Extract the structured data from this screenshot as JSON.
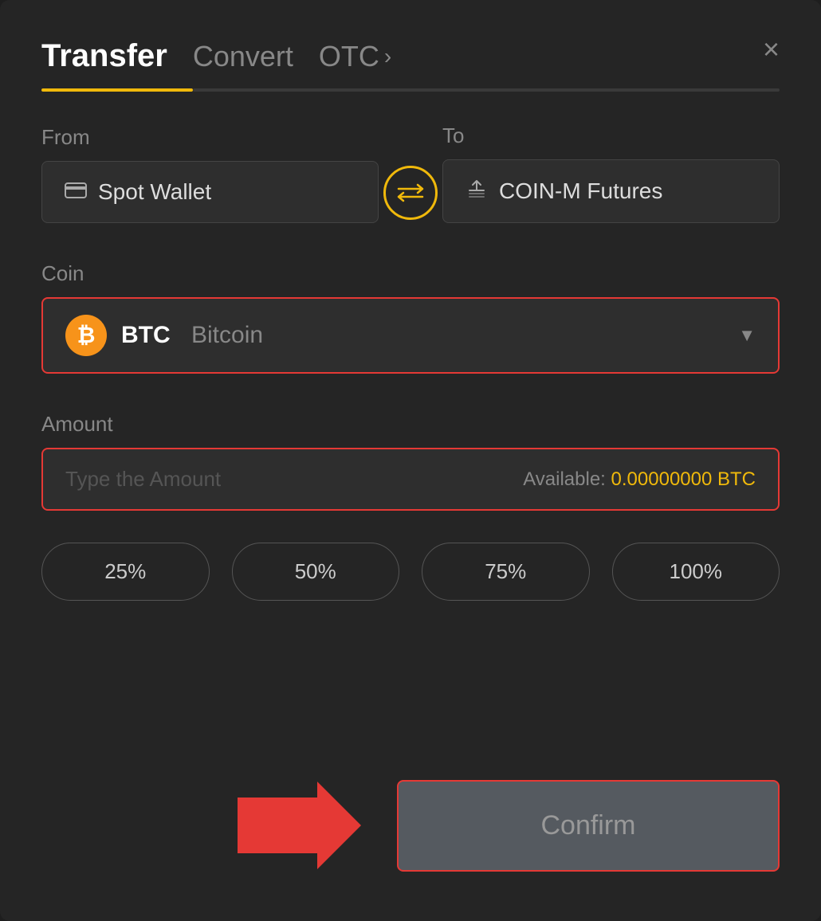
{
  "header": {
    "tab_transfer": "Transfer",
    "tab_convert": "Convert",
    "tab_otc": "OTC",
    "close_label": "×"
  },
  "from_section": {
    "label": "From",
    "wallet_icon": "🪙",
    "wallet_name": "Spot Wallet"
  },
  "to_section": {
    "label": "To",
    "wallet_name": "COIN-M Futures"
  },
  "swap": {
    "icon": "⇄"
  },
  "coin_section": {
    "label": "Coin",
    "coin_ticker": "BTC",
    "coin_name": "Bitcoin",
    "btc_symbol": "₿"
  },
  "amount_section": {
    "label": "Amount",
    "placeholder": "Type the Amount",
    "available_label": "Available:",
    "available_value": "0.00000000 BTC"
  },
  "percent_buttons": [
    "25%",
    "50%",
    "75%",
    "100%"
  ],
  "confirm_button": {
    "label": "Confirm"
  },
  "colors": {
    "accent_gold": "#f0b90b",
    "accent_red": "#e53935",
    "bg_dark": "#252525",
    "bg_input": "#2e2e2e"
  }
}
